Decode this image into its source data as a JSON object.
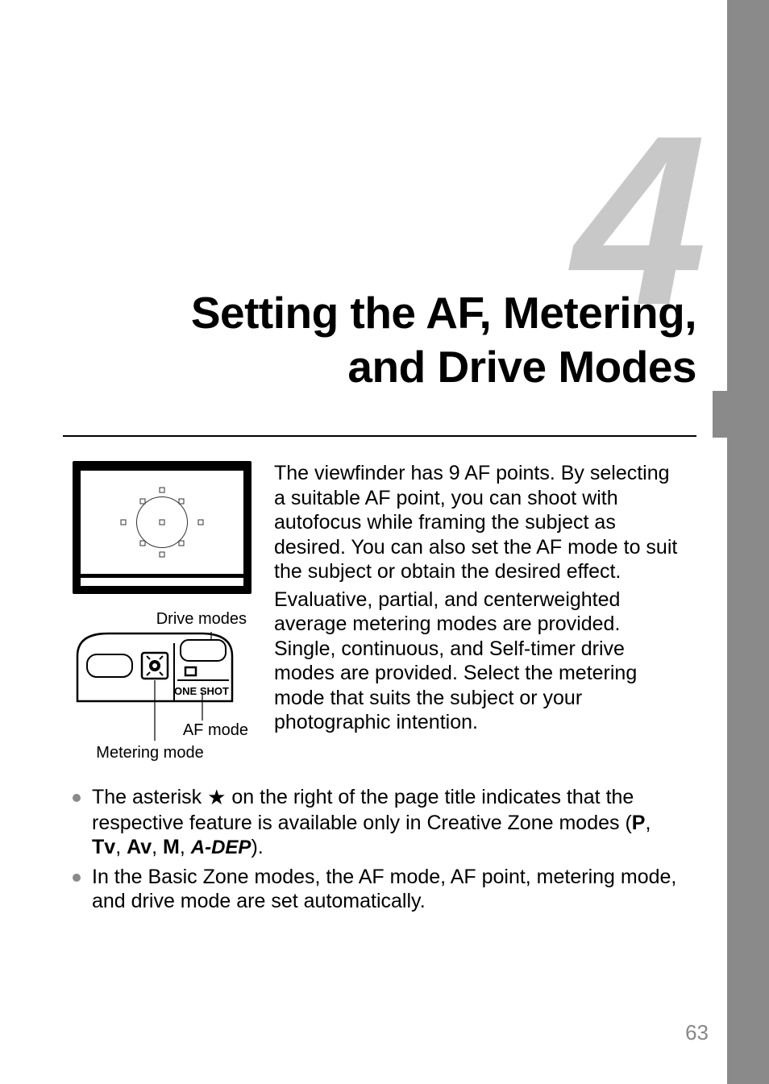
{
  "chapter": {
    "number": "4",
    "title_line1": "Setting the AF, Metering,",
    "title_line2": "and Drive Modes"
  },
  "paragraphs": {
    "p1": "The viewfinder has 9 AF points. By selecting a suitable AF point, you can shoot with autofocus while framing the subject as desired. You can also set the AF mode to suit the subject or obtain the desired effect.",
    "p2": "Evaluative, partial, and centerweighted average metering modes are provided. Single, continuous, and Self-timer drive modes are provided. Select the metering mode that suits the subject or your photographic intention."
  },
  "lcd": {
    "drive_modes_label": "Drive modes",
    "af_mode_label": "AF mode",
    "metering_mode_label": "Metering mode",
    "one_shot_text": "ONE SHOT"
  },
  "bullets": {
    "b1_part1": "The asterisk ",
    "b1_star": "★",
    "b1_part2": " on the right of the page title indicates that the respective feature is available only in Creative Zone modes (",
    "b1_modes": {
      "p": "P",
      "tv": "Tv",
      "av": "Av",
      "m": "M",
      "adep": "A-DEP"
    },
    "b1_part3": ").",
    "b2": "In the Basic Zone modes, the AF mode, AF point, metering mode, and drive mode are set automatically."
  },
  "page_number": "63"
}
